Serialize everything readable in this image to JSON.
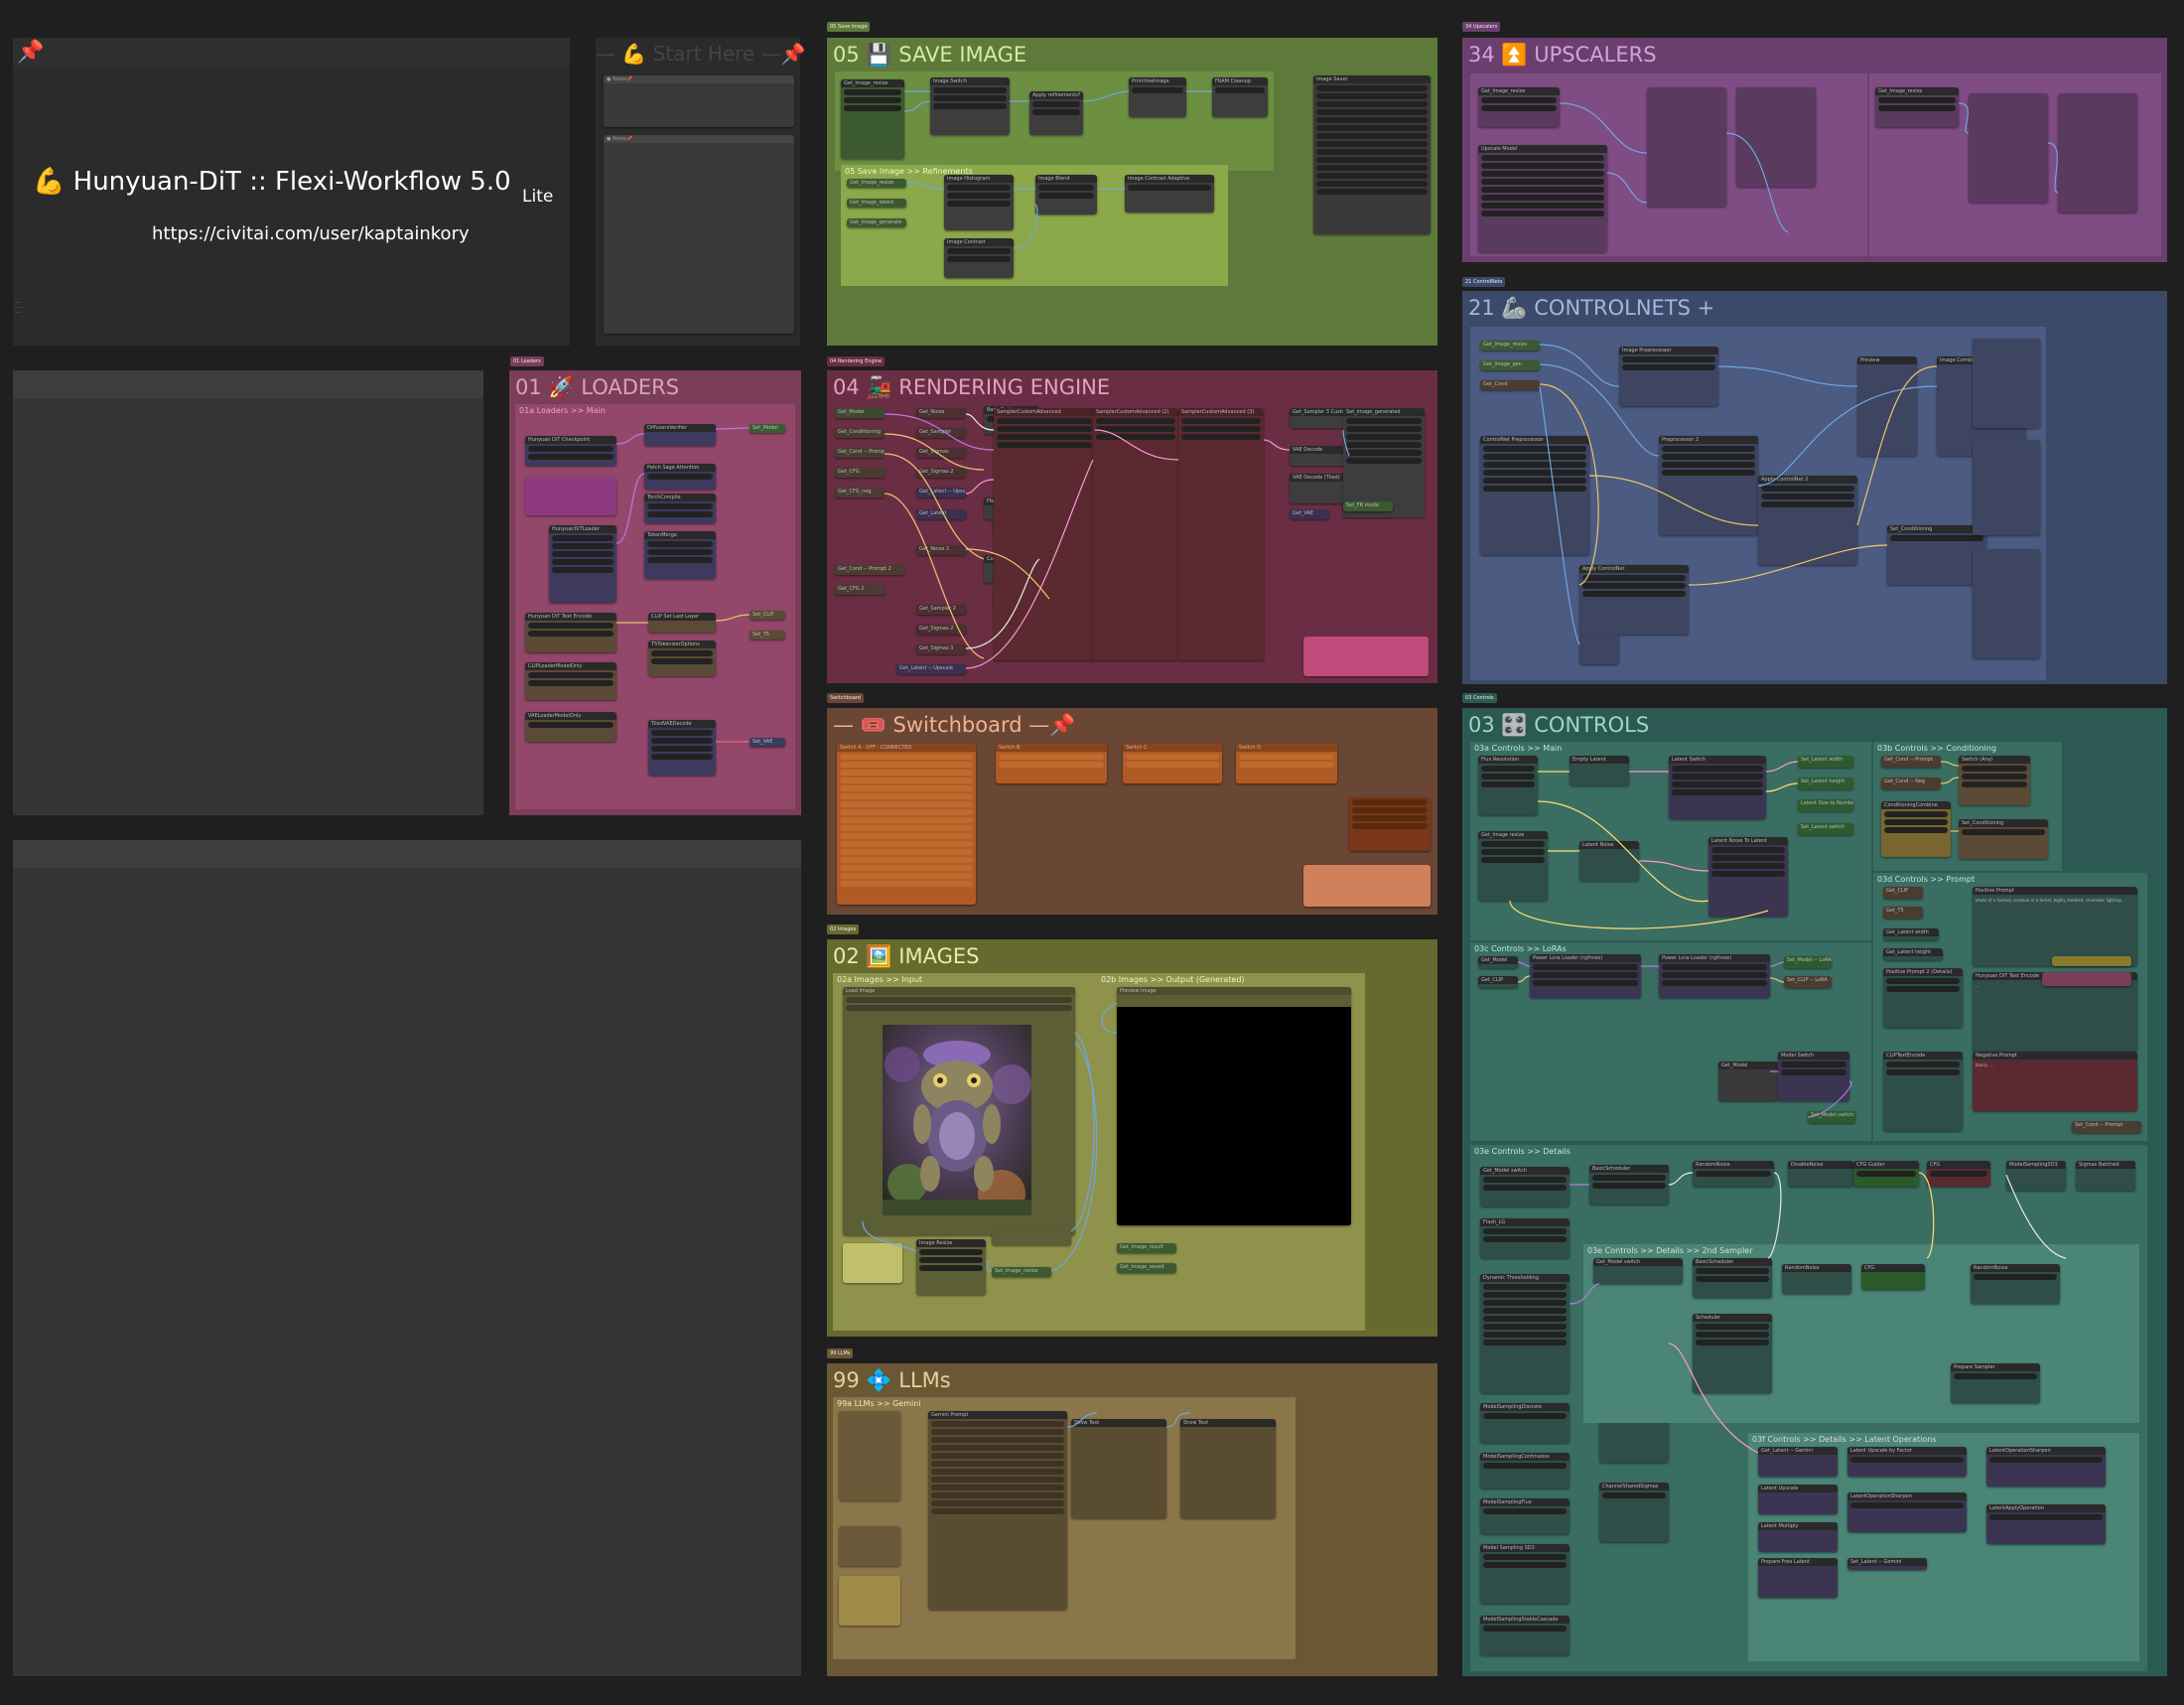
{
  "title_panel": {
    "pin": "📌",
    "title": "💪 Hunyuan-DiT :: Flexi-Workflow 5.0",
    "edition": "Lite",
    "url": "https://civitai.com/user/kaptainkory"
  },
  "start_here": {
    "title": "— 💪 Start Here —📌"
  },
  "groups": {
    "save_image": {
      "number": "05",
      "icon": "💾",
      "label": "SAVE IMAGE",
      "sub": [
        "05 Save Image >> Refinements"
      ]
    },
    "upscalers": {
      "number": "34",
      "icon": "⏫",
      "label": "UPSCALERS"
    },
    "loaders": {
      "number": "01",
      "icon": "🚀",
      "label": "LOADERS",
      "sub": [
        "01a Loaders >> Main"
      ]
    },
    "rendering": {
      "number": "04",
      "icon": "🚂",
      "label": "RENDERING ENGINE"
    },
    "controlnets": {
      "number": "21",
      "icon": "🦾",
      "label": "CONTROLNETS +"
    },
    "switchboard": {
      "number": "",
      "icon": "🎟️",
      "label": "— 🎟️ Switchboard —📌"
    },
    "controls": {
      "number": "03",
      "icon": "🎛️",
      "label": "CONTROLS",
      "sub": [
        "03a Controls >> Main",
        "03b Controls >> Conditioning",
        "03c Controls >> LoRAs",
        "03d Controls >> Prompt",
        "03e Controls >> Details",
        "03f Controls >> Details >> Latent Operations"
      ]
    },
    "images": {
      "number": "02",
      "icon": "🖼️",
      "label": "IMAGES",
      "sub": [
        "02a Images >> Input",
        "02b Images >> Output (Generated)"
      ]
    },
    "llms": {
      "number": "99",
      "icon": "💠",
      "label": "LLMs",
      "sub": [
        "99a LLMs >> Gemini"
      ]
    }
  },
  "colors": {
    "canvas": "#1f1f1f",
    "save_image": "#5d7a3a",
    "upscalers": "#6a3f6e",
    "loaders": "#7b3d58",
    "rendering": "#6a2e44",
    "controlnets": "#3b4a69",
    "switchboard": "#6a4634",
    "controls": "#2c5a52",
    "images": "#676a2f",
    "llms": "#6a5734"
  }
}
